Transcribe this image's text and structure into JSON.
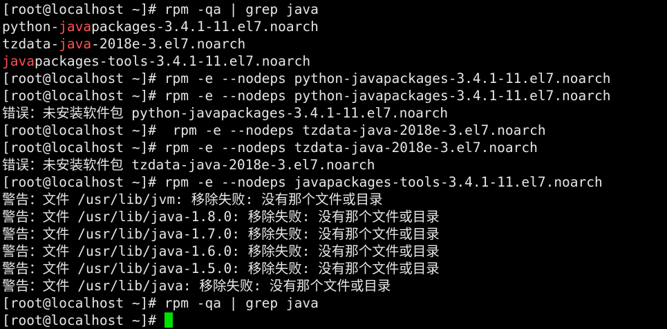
{
  "terminal": {
    "highlight_color": "#ff5050",
    "text_color": "#e6e6e6",
    "background_color": "#000000",
    "cursor_color": "#00e000",
    "lines": [
      [
        {
          "text": "[root@localhost ~]# rpm -qa | grep java",
          "hl": false
        }
      ],
      [
        {
          "text": "python-",
          "hl": false
        },
        {
          "text": "java",
          "hl": true
        },
        {
          "text": "packages-3.4.1-11.el7.noarch",
          "hl": false
        }
      ],
      [
        {
          "text": "tzdata-",
          "hl": false
        },
        {
          "text": "java",
          "hl": true
        },
        {
          "text": "-2018e-3.el7.noarch",
          "hl": false
        }
      ],
      [
        {
          "text": "java",
          "hl": true
        },
        {
          "text": "packages-tools-3.4.1-11.el7.noarch",
          "hl": false
        }
      ],
      [
        {
          "text": "[root@localhost ~]# rpm -e --nodeps python-javapackages-3.4.1-11.el7.noarch",
          "hl": false
        }
      ],
      [
        {
          "text": "[root@localhost ~]# rpm -e --nodeps python-javapackages-3.4.1-11.el7.noarch",
          "hl": false
        }
      ],
      [
        {
          "text": "错误：未安装软件包 python-javapackages-3.4.1-11.el7.noarch",
          "hl": false
        }
      ],
      [
        {
          "text": "[root@localhost ~]#  rpm -e --nodeps tzdata-java-2018e-3.el7.noarch",
          "hl": false
        }
      ],
      [
        {
          "text": "[root@localhost ~]# rpm -e --nodeps tzdata-java-2018e-3.el7.noarch",
          "hl": false
        }
      ],
      [
        {
          "text": "错误：未安装软件包 tzdata-java-2018e-3.el7.noarch",
          "hl": false
        }
      ],
      [
        {
          "text": "[root@localhost ~]# rpm -e --nodeps javapackages-tools-3.4.1-11.el7.noarch",
          "hl": false
        }
      ],
      [
        {
          "text": "警告：文件 /usr/lib/jvm: 移除失败: 没有那个文件或目录",
          "hl": false
        }
      ],
      [
        {
          "text": "警告：文件 /usr/lib/java-1.8.0: 移除失败: 没有那个文件或目录",
          "hl": false
        }
      ],
      [
        {
          "text": "警告：文件 /usr/lib/java-1.7.0: 移除失败: 没有那个文件或目录",
          "hl": false
        }
      ],
      [
        {
          "text": "警告：文件 /usr/lib/java-1.6.0: 移除失败: 没有那个文件或目录",
          "hl": false
        }
      ],
      [
        {
          "text": "警告：文件 /usr/lib/java-1.5.0: 移除失败: 没有那个文件或目录",
          "hl": false
        }
      ],
      [
        {
          "text": "警告：文件 /usr/lib/java: 移除失败: 没有那个文件或目录",
          "hl": false
        }
      ],
      [
        {
          "text": "[root@localhost ~]# rpm -qa | grep java",
          "hl": false
        }
      ],
      [
        {
          "text": "[root@localhost ~]# ",
          "hl": false
        }
      ]
    ]
  }
}
